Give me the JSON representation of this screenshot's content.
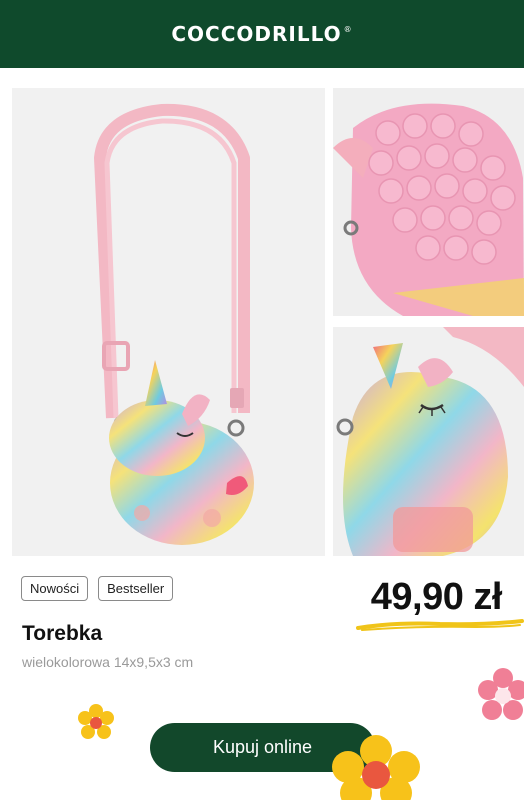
{
  "header": {
    "brand": "COCCODRILLO",
    "registered": "®"
  },
  "gallery": {
    "main_alt": "pink strap crossbody bag with rainbow unicorn pop-it",
    "top_alt": "close-up of pink pop-it bubbles",
    "bottom_alt": "unicorn head with rainbow horn"
  },
  "product": {
    "badges": [
      "Nowości",
      "Bestseller"
    ],
    "price": "49,90 zł",
    "title": "Torebka",
    "description": "wielokolorowa 14x9,5x3 cm"
  },
  "cta": {
    "label": "Kupuj online"
  },
  "colors": {
    "header_bg": "#0f4a2c",
    "button_bg": "#12482b",
    "price_underline": "#f0c419",
    "flower_pink": "#f07f96",
    "flower_yellow": "#f7c21a"
  }
}
